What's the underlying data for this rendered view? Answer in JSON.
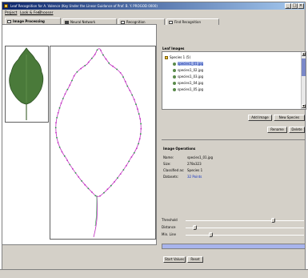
{
  "window": {
    "title": "Leaf Recognition for A. Valence (Key Under the Linear Guidance of Prof. B. Y. PROGOD 0000)",
    "minimize": "_",
    "maximize": "□",
    "close": "×"
  },
  "menu": [
    "Project",
    "Look & Feel",
    "Chooser"
  ],
  "tabs": [
    {
      "label": "Image Processing",
      "active": true
    },
    {
      "label": "Neural Network",
      "active": false
    },
    {
      "label": "Recognition",
      "active": false
    },
    {
      "label": "Find Recognition",
      "active": false
    }
  ],
  "leaf_images": {
    "title": "Leaf Images",
    "tree": [
      {
        "label": "Species 1 (5)",
        "level": 0,
        "selected": false,
        "icon": "folder-icon"
      },
      {
        "label": "species1_01.jpg",
        "level": 1,
        "selected": true,
        "icon": "leaf-file-icon"
      },
      {
        "label": "species1_02.jpg",
        "level": 1,
        "selected": false,
        "icon": "leaf-file-icon"
      },
      {
        "label": "species1_03.jpg",
        "level": 1,
        "selected": false,
        "icon": "leaf-file-icon"
      },
      {
        "label": "species1_04.jpg",
        "level": 1,
        "selected": false,
        "icon": "leaf-file-icon"
      },
      {
        "label": "species1_05.jpg",
        "level": 1,
        "selected": false,
        "icon": "leaf-file-icon"
      }
    ],
    "buttons": {
      "add_image": "Add Image",
      "new_species": "New Species",
      "rename": "Rename",
      "delete": "Delete"
    }
  },
  "image_operations": {
    "title": "Image Operations",
    "rows": [
      {
        "label": "Name:",
        "value": "species1_01.jpg",
        "blue": false
      },
      {
        "label": "Size:",
        "value": "278x323",
        "blue": false
      },
      {
        "label": "Classified as:",
        "value": "Species 1",
        "blue": false
      },
      {
        "label": "Datasets:",
        "value": "32 Points",
        "blue": true
      }
    ]
  },
  "sliders": [
    {
      "label": "Threshold",
      "fraction": 0.75
    },
    {
      "label": "Distance",
      "fraction": 0.06
    },
    {
      "label": "Min. Line",
      "fraction": 0.2
    }
  ],
  "progress": {
    "fraction": 1.0
  },
  "bottom_buttons": {
    "start_values": "Start Values",
    "reset": "Reset"
  },
  "colors": {
    "leaf_fill": "#4a7a3a",
    "outline_stroke": "#c030c0",
    "outline_points": "#20a040",
    "selection": "#a8b8e8"
  }
}
